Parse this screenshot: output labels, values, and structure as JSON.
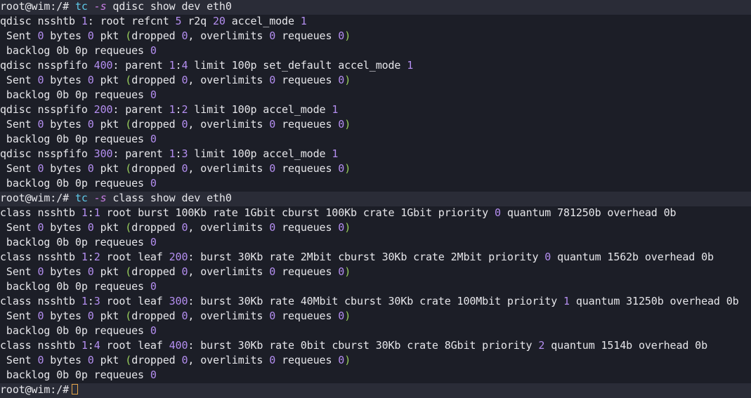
{
  "colors": {
    "background": "#1c1e27",
    "command_line_bg": "#2a2c37",
    "text": "#e6e6ea",
    "number": "#b48ef0",
    "command": "#5ec8e8",
    "option": "#c77ce3",
    "paren": "#9ad05c",
    "cursor": "#e5a64a"
  },
  "lines": [
    {
      "type": "command",
      "tokens": [
        {
          "t": "prompt",
          "v": "root@wim:/# "
        },
        {
          "t": "kw",
          "v": "tc"
        },
        {
          "t": "sym",
          "v": " "
        },
        {
          "t": "opt",
          "v": "-s"
        },
        {
          "t": "sym",
          "v": " qdisc show dev eth0"
        }
      ]
    },
    {
      "type": "output",
      "tokens": [
        {
          "t": "sym",
          "v": "qdisc nsshtb "
        },
        {
          "t": "num",
          "v": "1"
        },
        {
          "t": "sym",
          "v": ": root refcnt "
        },
        {
          "t": "num",
          "v": "5"
        },
        {
          "t": "sym",
          "v": " r2q "
        },
        {
          "t": "num",
          "v": "20"
        },
        {
          "t": "sym",
          "v": " accel_mode "
        },
        {
          "t": "num",
          "v": "1"
        }
      ]
    },
    {
      "type": "output",
      "tokens": [
        {
          "t": "sym",
          "v": " Sent "
        },
        {
          "t": "num",
          "v": "0"
        },
        {
          "t": "sym",
          "v": " bytes "
        },
        {
          "t": "num",
          "v": "0"
        },
        {
          "t": "sym",
          "v": " pkt "
        },
        {
          "t": "paren",
          "v": "("
        },
        {
          "t": "sym",
          "v": "dropped "
        },
        {
          "t": "num",
          "v": "0"
        },
        {
          "t": "sym",
          "v": ", overlimits "
        },
        {
          "t": "num",
          "v": "0"
        },
        {
          "t": "sym",
          "v": " requeues "
        },
        {
          "t": "num",
          "v": "0"
        },
        {
          "t": "paren",
          "v": ")"
        }
      ]
    },
    {
      "type": "output",
      "tokens": [
        {
          "t": "sym",
          "v": " backlog 0b 0p requeues "
        },
        {
          "t": "num",
          "v": "0"
        }
      ]
    },
    {
      "type": "output",
      "tokens": [
        {
          "t": "sym",
          "v": "qdisc nsspfifo "
        },
        {
          "t": "num",
          "v": "400"
        },
        {
          "t": "sym",
          "v": ": parent "
        },
        {
          "t": "num",
          "v": "1"
        },
        {
          "t": "sym",
          "v": ":"
        },
        {
          "t": "num",
          "v": "4"
        },
        {
          "t": "sym",
          "v": " limit 100p set_default accel_mode "
        },
        {
          "t": "num",
          "v": "1"
        }
      ]
    },
    {
      "type": "output",
      "tokens": [
        {
          "t": "sym",
          "v": " Sent "
        },
        {
          "t": "num",
          "v": "0"
        },
        {
          "t": "sym",
          "v": " bytes "
        },
        {
          "t": "num",
          "v": "0"
        },
        {
          "t": "sym",
          "v": " pkt "
        },
        {
          "t": "paren",
          "v": "("
        },
        {
          "t": "sym",
          "v": "dropped "
        },
        {
          "t": "num",
          "v": "0"
        },
        {
          "t": "sym",
          "v": ", overlimits "
        },
        {
          "t": "num",
          "v": "0"
        },
        {
          "t": "sym",
          "v": " requeues "
        },
        {
          "t": "num",
          "v": "0"
        },
        {
          "t": "paren",
          "v": ")"
        }
      ]
    },
    {
      "type": "output",
      "tokens": [
        {
          "t": "sym",
          "v": " backlog 0b 0p requeues "
        },
        {
          "t": "num",
          "v": "0"
        }
      ]
    },
    {
      "type": "output",
      "tokens": [
        {
          "t": "sym",
          "v": "qdisc nsspfifo "
        },
        {
          "t": "num",
          "v": "200"
        },
        {
          "t": "sym",
          "v": ": parent "
        },
        {
          "t": "num",
          "v": "1"
        },
        {
          "t": "sym",
          "v": ":"
        },
        {
          "t": "num",
          "v": "2"
        },
        {
          "t": "sym",
          "v": " limit 100p accel_mode "
        },
        {
          "t": "num",
          "v": "1"
        }
      ]
    },
    {
      "type": "output",
      "tokens": [
        {
          "t": "sym",
          "v": " Sent "
        },
        {
          "t": "num",
          "v": "0"
        },
        {
          "t": "sym",
          "v": " bytes "
        },
        {
          "t": "num",
          "v": "0"
        },
        {
          "t": "sym",
          "v": " pkt "
        },
        {
          "t": "paren",
          "v": "("
        },
        {
          "t": "sym",
          "v": "dropped "
        },
        {
          "t": "num",
          "v": "0"
        },
        {
          "t": "sym",
          "v": ", overlimits "
        },
        {
          "t": "num",
          "v": "0"
        },
        {
          "t": "sym",
          "v": " requeues "
        },
        {
          "t": "num",
          "v": "0"
        },
        {
          "t": "paren",
          "v": ")"
        }
      ]
    },
    {
      "type": "output",
      "tokens": [
        {
          "t": "sym",
          "v": " backlog 0b 0p requeues "
        },
        {
          "t": "num",
          "v": "0"
        }
      ]
    },
    {
      "type": "output",
      "tokens": [
        {
          "t": "sym",
          "v": "qdisc nsspfifo "
        },
        {
          "t": "num",
          "v": "300"
        },
        {
          "t": "sym",
          "v": ": parent "
        },
        {
          "t": "num",
          "v": "1"
        },
        {
          "t": "sym",
          "v": ":"
        },
        {
          "t": "num",
          "v": "3"
        },
        {
          "t": "sym",
          "v": " limit 100p accel_mode "
        },
        {
          "t": "num",
          "v": "1"
        }
      ]
    },
    {
      "type": "output",
      "tokens": [
        {
          "t": "sym",
          "v": " Sent "
        },
        {
          "t": "num",
          "v": "0"
        },
        {
          "t": "sym",
          "v": " bytes "
        },
        {
          "t": "num",
          "v": "0"
        },
        {
          "t": "sym",
          "v": " pkt "
        },
        {
          "t": "paren",
          "v": "("
        },
        {
          "t": "sym",
          "v": "dropped "
        },
        {
          "t": "num",
          "v": "0"
        },
        {
          "t": "sym",
          "v": ", overlimits "
        },
        {
          "t": "num",
          "v": "0"
        },
        {
          "t": "sym",
          "v": " requeues "
        },
        {
          "t": "num",
          "v": "0"
        },
        {
          "t": "paren",
          "v": ")"
        }
      ]
    },
    {
      "type": "output",
      "tokens": [
        {
          "t": "sym",
          "v": " backlog 0b 0p requeues "
        },
        {
          "t": "num",
          "v": "0"
        }
      ]
    },
    {
      "type": "command",
      "tokens": [
        {
          "t": "prompt",
          "v": "root@wim:/# "
        },
        {
          "t": "kw",
          "v": "tc"
        },
        {
          "t": "sym",
          "v": " "
        },
        {
          "t": "opt",
          "v": "-s"
        },
        {
          "t": "sym",
          "v": " class show dev eth0"
        }
      ]
    },
    {
      "type": "output",
      "tokens": [
        {
          "t": "sym",
          "v": "class nsshtb "
        },
        {
          "t": "num",
          "v": "1"
        },
        {
          "t": "sym",
          "v": ":"
        },
        {
          "t": "num",
          "v": "1"
        },
        {
          "t": "sym",
          "v": " root burst 100Kb rate 1Gbit cburst 100Kb crate 1Gbit priority "
        },
        {
          "t": "num",
          "v": "0"
        },
        {
          "t": "sym",
          "v": " quantum 781250b overhead 0b"
        }
      ]
    },
    {
      "type": "output",
      "tokens": [
        {
          "t": "sym",
          "v": " Sent "
        },
        {
          "t": "num",
          "v": "0"
        },
        {
          "t": "sym",
          "v": " bytes "
        },
        {
          "t": "num",
          "v": "0"
        },
        {
          "t": "sym",
          "v": " pkt "
        },
        {
          "t": "paren",
          "v": "("
        },
        {
          "t": "sym",
          "v": "dropped "
        },
        {
          "t": "num",
          "v": "0"
        },
        {
          "t": "sym",
          "v": ", overlimits "
        },
        {
          "t": "num",
          "v": "0"
        },
        {
          "t": "sym",
          "v": " requeues "
        },
        {
          "t": "num",
          "v": "0"
        },
        {
          "t": "paren",
          "v": ")"
        }
      ]
    },
    {
      "type": "output",
      "tokens": [
        {
          "t": "sym",
          "v": " backlog 0b 0p requeues "
        },
        {
          "t": "num",
          "v": "0"
        }
      ]
    },
    {
      "type": "output",
      "tokens": [
        {
          "t": "sym",
          "v": "class nsshtb "
        },
        {
          "t": "num",
          "v": "1"
        },
        {
          "t": "sym",
          "v": ":"
        },
        {
          "t": "num",
          "v": "2"
        },
        {
          "t": "sym",
          "v": " root leaf "
        },
        {
          "t": "num",
          "v": "200"
        },
        {
          "t": "sym",
          "v": ": burst 30Kb rate 2Mbit cburst 30Kb crate 2Mbit priority "
        },
        {
          "t": "num",
          "v": "0"
        },
        {
          "t": "sym",
          "v": " quantum 1562b overhead 0b"
        }
      ]
    },
    {
      "type": "output",
      "tokens": [
        {
          "t": "sym",
          "v": " Sent "
        },
        {
          "t": "num",
          "v": "0"
        },
        {
          "t": "sym",
          "v": " bytes "
        },
        {
          "t": "num",
          "v": "0"
        },
        {
          "t": "sym",
          "v": " pkt "
        },
        {
          "t": "paren",
          "v": "("
        },
        {
          "t": "sym",
          "v": "dropped "
        },
        {
          "t": "num",
          "v": "0"
        },
        {
          "t": "sym",
          "v": ", overlimits "
        },
        {
          "t": "num",
          "v": "0"
        },
        {
          "t": "sym",
          "v": " requeues "
        },
        {
          "t": "num",
          "v": "0"
        },
        {
          "t": "paren",
          "v": ")"
        }
      ]
    },
    {
      "type": "output",
      "tokens": [
        {
          "t": "sym",
          "v": " backlog 0b 0p requeues "
        },
        {
          "t": "num",
          "v": "0"
        }
      ]
    },
    {
      "type": "output",
      "tokens": [
        {
          "t": "sym",
          "v": "class nsshtb "
        },
        {
          "t": "num",
          "v": "1"
        },
        {
          "t": "sym",
          "v": ":"
        },
        {
          "t": "num",
          "v": "3"
        },
        {
          "t": "sym",
          "v": " root leaf "
        },
        {
          "t": "num",
          "v": "300"
        },
        {
          "t": "sym",
          "v": ": burst 30Kb rate 40Mbit cburst 30Kb crate 100Mbit priority "
        },
        {
          "t": "num",
          "v": "1"
        },
        {
          "t": "sym",
          "v": " quantum 31250b overhead 0b"
        }
      ]
    },
    {
      "type": "output",
      "tokens": [
        {
          "t": "sym",
          "v": " Sent "
        },
        {
          "t": "num",
          "v": "0"
        },
        {
          "t": "sym",
          "v": " bytes "
        },
        {
          "t": "num",
          "v": "0"
        },
        {
          "t": "sym",
          "v": " pkt "
        },
        {
          "t": "paren",
          "v": "("
        },
        {
          "t": "sym",
          "v": "dropped "
        },
        {
          "t": "num",
          "v": "0"
        },
        {
          "t": "sym",
          "v": ", overlimits "
        },
        {
          "t": "num",
          "v": "0"
        },
        {
          "t": "sym",
          "v": " requeues "
        },
        {
          "t": "num",
          "v": "0"
        },
        {
          "t": "paren",
          "v": ")"
        }
      ]
    },
    {
      "type": "output",
      "tokens": [
        {
          "t": "sym",
          "v": " backlog 0b 0p requeues "
        },
        {
          "t": "num",
          "v": "0"
        }
      ]
    },
    {
      "type": "output",
      "tokens": [
        {
          "t": "sym",
          "v": "class nsshtb "
        },
        {
          "t": "num",
          "v": "1"
        },
        {
          "t": "sym",
          "v": ":"
        },
        {
          "t": "num",
          "v": "4"
        },
        {
          "t": "sym",
          "v": " root leaf "
        },
        {
          "t": "num",
          "v": "400"
        },
        {
          "t": "sym",
          "v": ": burst 30Kb rate 0bit cburst 30Kb crate 8Gbit priority "
        },
        {
          "t": "num",
          "v": "2"
        },
        {
          "t": "sym",
          "v": " quantum 1514b overhead 0b"
        }
      ]
    },
    {
      "type": "output",
      "tokens": [
        {
          "t": "sym",
          "v": " Sent "
        },
        {
          "t": "num",
          "v": "0"
        },
        {
          "t": "sym",
          "v": " bytes "
        },
        {
          "t": "num",
          "v": "0"
        },
        {
          "t": "sym",
          "v": " pkt "
        },
        {
          "t": "paren",
          "v": "("
        },
        {
          "t": "sym",
          "v": "dropped "
        },
        {
          "t": "num",
          "v": "0"
        },
        {
          "t": "sym",
          "v": ", overlimits "
        },
        {
          "t": "num",
          "v": "0"
        },
        {
          "t": "sym",
          "v": " requeues "
        },
        {
          "t": "num",
          "v": "0"
        },
        {
          "t": "paren",
          "v": ")"
        }
      ]
    },
    {
      "type": "output",
      "tokens": [
        {
          "t": "sym",
          "v": " backlog 0b 0p requeues "
        },
        {
          "t": "num",
          "v": "0"
        }
      ]
    },
    {
      "type": "command",
      "cursor": true,
      "tokens": [
        {
          "t": "prompt",
          "v": "root@wim:/#"
        }
      ]
    }
  ]
}
